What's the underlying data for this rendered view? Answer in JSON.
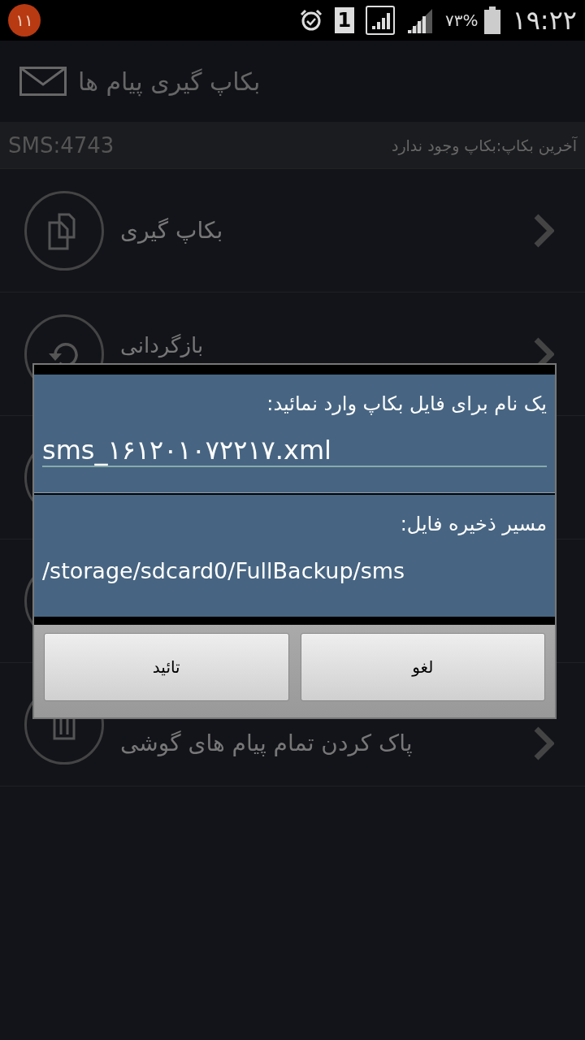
{
  "status_bar": {
    "notification_count": "۱۱",
    "sim_slot": "1",
    "battery_percent": "۷۳%",
    "time": "۱۹:۲۲"
  },
  "header": {
    "title": "بکاپ گیری پیام ها"
  },
  "info_bar": {
    "last_backup": "آخرین بکاپ:بکاپ وجود ندارد",
    "sms_count": "SMS:4743"
  },
  "menu": [
    {
      "kind": "backup",
      "label": "بکاپ گیری"
    },
    {
      "kind": "restore",
      "label": "بازگردانی"
    },
    {
      "kind": "hidden"
    },
    {
      "kind": "hidden"
    },
    {
      "kind": "delete",
      "label": "پاک کردن تمام پیام های گوشی"
    }
  ],
  "dialog": {
    "name_prompt": "یک نام برای فایل بکاپ وارد نمائید:",
    "file_name": "sms_۱۶۱۲۰۱۰۷۲۲۱۷.xml",
    "path_prompt": "مسیر ذخیره فایل:",
    "path": "/storage/sdcard0/FullBackup/sms",
    "buttons": [
      "لغو",
      "تائید"
    ]
  }
}
